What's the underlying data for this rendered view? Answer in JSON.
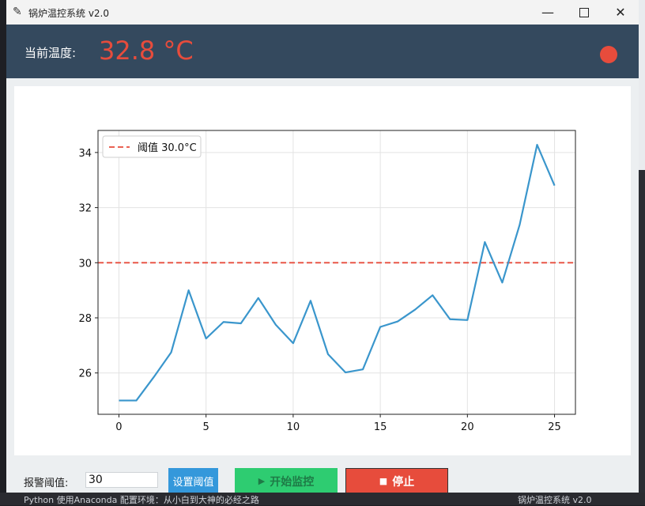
{
  "window": {
    "title": "锅炉温控系统 v2.0",
    "minimize_glyph": "—",
    "close_glyph": "✕"
  },
  "header": {
    "temp_label": "当前温度:",
    "temp_value": "32.8 °C",
    "status_color": "#e74c3c"
  },
  "controls": {
    "threshold_label": "报警阈值:",
    "threshold_value": "30",
    "set_button": "设置阈值",
    "start_button": "开始监控",
    "start_icon": "▶",
    "stop_button": "停止",
    "stop_icon": "■"
  },
  "background": {
    "taskbar_left": "Python 使用Anaconda 配置环境：从小白到大神的必经之路",
    "taskbar_right": "锅炉温控系统 v2.0"
  },
  "colors": {
    "header_bg": "#34495e",
    "line": "#3a96cc",
    "threshold_line": "#e74c3c",
    "set_button": "#3498db",
    "start_button": "#2ecc71",
    "stop_button": "#e74c3c"
  },
  "chart_data": {
    "type": "line",
    "x": [
      0,
      1,
      2,
      3,
      4,
      5,
      6,
      7,
      8,
      9,
      10,
      11,
      12,
      13,
      14,
      15,
      16,
      17,
      18,
      19,
      20,
      21,
      22,
      23,
      24,
      25
    ],
    "series": [
      {
        "values": [
          25.0,
          25.0,
          25.85,
          26.75,
          29.0,
          27.25,
          27.85,
          27.8,
          28.72,
          27.75,
          27.08,
          28.62,
          26.68,
          26.02,
          26.13,
          27.67,
          27.87,
          28.3,
          28.82,
          27.95,
          27.92,
          30.75,
          29.28,
          31.38,
          34.28,
          32.8
        ]
      }
    ],
    "threshold": {
      "value": 30.0,
      "label": "阈值 30.0°C"
    },
    "xlim": [
      -1.2,
      26.2
    ],
    "ylim": [
      24.5,
      34.8
    ],
    "xticks": [
      0,
      5,
      10,
      15,
      20,
      25
    ],
    "yticks": [
      26,
      28,
      30,
      32,
      34
    ],
    "grid": true,
    "legend": "top-left"
  }
}
